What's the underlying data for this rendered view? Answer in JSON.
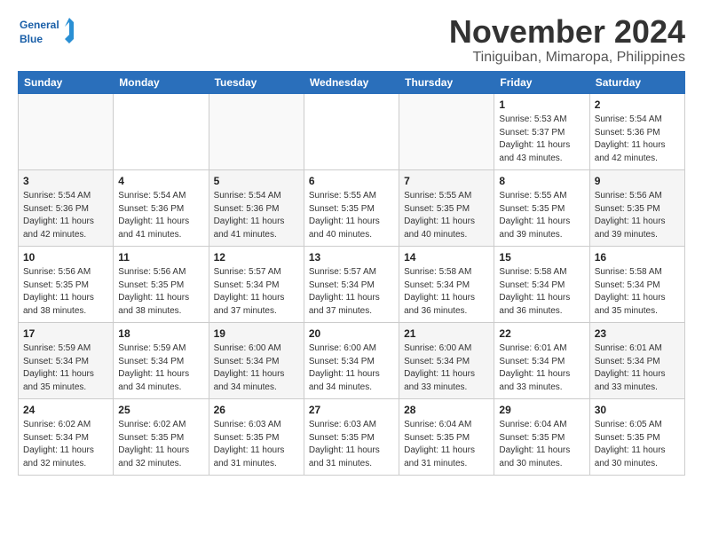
{
  "header": {
    "logo_line1": "General",
    "logo_line2": "Blue",
    "title": "November 2024",
    "subtitle": "Tiniguiban, Mimaropa, Philippines"
  },
  "columns": [
    "Sunday",
    "Monday",
    "Tuesday",
    "Wednesday",
    "Thursday",
    "Friday",
    "Saturday"
  ],
  "weeks": [
    [
      {
        "day": "",
        "info": ""
      },
      {
        "day": "",
        "info": ""
      },
      {
        "day": "",
        "info": ""
      },
      {
        "day": "",
        "info": ""
      },
      {
        "day": "",
        "info": ""
      },
      {
        "day": "1",
        "info": "Sunrise: 5:53 AM\nSunset: 5:37 PM\nDaylight: 11 hours\nand 43 minutes."
      },
      {
        "day": "2",
        "info": "Sunrise: 5:54 AM\nSunset: 5:36 PM\nDaylight: 11 hours\nand 42 minutes."
      }
    ],
    [
      {
        "day": "3",
        "info": "Sunrise: 5:54 AM\nSunset: 5:36 PM\nDaylight: 11 hours\nand 42 minutes."
      },
      {
        "day": "4",
        "info": "Sunrise: 5:54 AM\nSunset: 5:36 PM\nDaylight: 11 hours\nand 41 minutes."
      },
      {
        "day": "5",
        "info": "Sunrise: 5:54 AM\nSunset: 5:36 PM\nDaylight: 11 hours\nand 41 minutes."
      },
      {
        "day": "6",
        "info": "Sunrise: 5:55 AM\nSunset: 5:35 PM\nDaylight: 11 hours\nand 40 minutes."
      },
      {
        "day": "7",
        "info": "Sunrise: 5:55 AM\nSunset: 5:35 PM\nDaylight: 11 hours\nand 40 minutes."
      },
      {
        "day": "8",
        "info": "Sunrise: 5:55 AM\nSunset: 5:35 PM\nDaylight: 11 hours\nand 39 minutes."
      },
      {
        "day": "9",
        "info": "Sunrise: 5:56 AM\nSunset: 5:35 PM\nDaylight: 11 hours\nand 39 minutes."
      }
    ],
    [
      {
        "day": "10",
        "info": "Sunrise: 5:56 AM\nSunset: 5:35 PM\nDaylight: 11 hours\nand 38 minutes."
      },
      {
        "day": "11",
        "info": "Sunrise: 5:56 AM\nSunset: 5:35 PM\nDaylight: 11 hours\nand 38 minutes."
      },
      {
        "day": "12",
        "info": "Sunrise: 5:57 AM\nSunset: 5:34 PM\nDaylight: 11 hours\nand 37 minutes."
      },
      {
        "day": "13",
        "info": "Sunrise: 5:57 AM\nSunset: 5:34 PM\nDaylight: 11 hours\nand 37 minutes."
      },
      {
        "day": "14",
        "info": "Sunrise: 5:58 AM\nSunset: 5:34 PM\nDaylight: 11 hours\nand 36 minutes."
      },
      {
        "day": "15",
        "info": "Sunrise: 5:58 AM\nSunset: 5:34 PM\nDaylight: 11 hours\nand 36 minutes."
      },
      {
        "day": "16",
        "info": "Sunrise: 5:58 AM\nSunset: 5:34 PM\nDaylight: 11 hours\nand 35 minutes."
      }
    ],
    [
      {
        "day": "17",
        "info": "Sunrise: 5:59 AM\nSunset: 5:34 PM\nDaylight: 11 hours\nand 35 minutes."
      },
      {
        "day": "18",
        "info": "Sunrise: 5:59 AM\nSunset: 5:34 PM\nDaylight: 11 hours\nand 34 minutes."
      },
      {
        "day": "19",
        "info": "Sunrise: 6:00 AM\nSunset: 5:34 PM\nDaylight: 11 hours\nand 34 minutes."
      },
      {
        "day": "20",
        "info": "Sunrise: 6:00 AM\nSunset: 5:34 PM\nDaylight: 11 hours\nand 34 minutes."
      },
      {
        "day": "21",
        "info": "Sunrise: 6:00 AM\nSunset: 5:34 PM\nDaylight: 11 hours\nand 33 minutes."
      },
      {
        "day": "22",
        "info": "Sunrise: 6:01 AM\nSunset: 5:34 PM\nDaylight: 11 hours\nand 33 minutes."
      },
      {
        "day": "23",
        "info": "Sunrise: 6:01 AM\nSunset: 5:34 PM\nDaylight: 11 hours\nand 33 minutes."
      }
    ],
    [
      {
        "day": "24",
        "info": "Sunrise: 6:02 AM\nSunset: 5:34 PM\nDaylight: 11 hours\nand 32 minutes."
      },
      {
        "day": "25",
        "info": "Sunrise: 6:02 AM\nSunset: 5:35 PM\nDaylight: 11 hours\nand 32 minutes."
      },
      {
        "day": "26",
        "info": "Sunrise: 6:03 AM\nSunset: 5:35 PM\nDaylight: 11 hours\nand 31 minutes."
      },
      {
        "day": "27",
        "info": "Sunrise: 6:03 AM\nSunset: 5:35 PM\nDaylight: 11 hours\nand 31 minutes."
      },
      {
        "day": "28",
        "info": "Sunrise: 6:04 AM\nSunset: 5:35 PM\nDaylight: 11 hours\nand 31 minutes."
      },
      {
        "day": "29",
        "info": "Sunrise: 6:04 AM\nSunset: 5:35 PM\nDaylight: 11 hours\nand 30 minutes."
      },
      {
        "day": "30",
        "info": "Sunrise: 6:05 AM\nSunset: 5:35 PM\nDaylight: 11 hours\nand 30 minutes."
      }
    ]
  ]
}
